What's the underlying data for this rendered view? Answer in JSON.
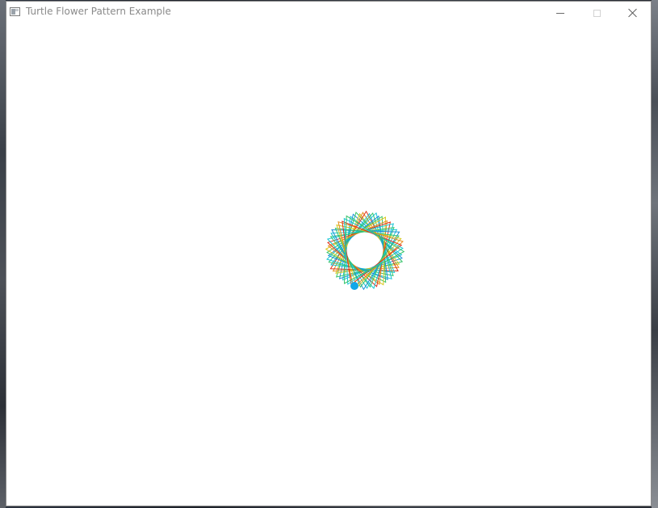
{
  "window": {
    "title": "Turtle Flower Pattern Example"
  },
  "icons": {
    "app": "app-window-icon",
    "minimize": "minimize-icon",
    "maximize": "maximize-icon",
    "close": "close-icon",
    "turtle": "turtle-cursor-icon"
  },
  "colors": {
    "pattern_cyan": "#16c6d6",
    "pattern_blue": "#1a8fd8",
    "pattern_green": "#35c46a",
    "pattern_yellow": "#d8c91e",
    "pattern_orange": "#e88b1a",
    "pattern_red": "#e0321c",
    "turtle": "#12a7e8"
  }
}
